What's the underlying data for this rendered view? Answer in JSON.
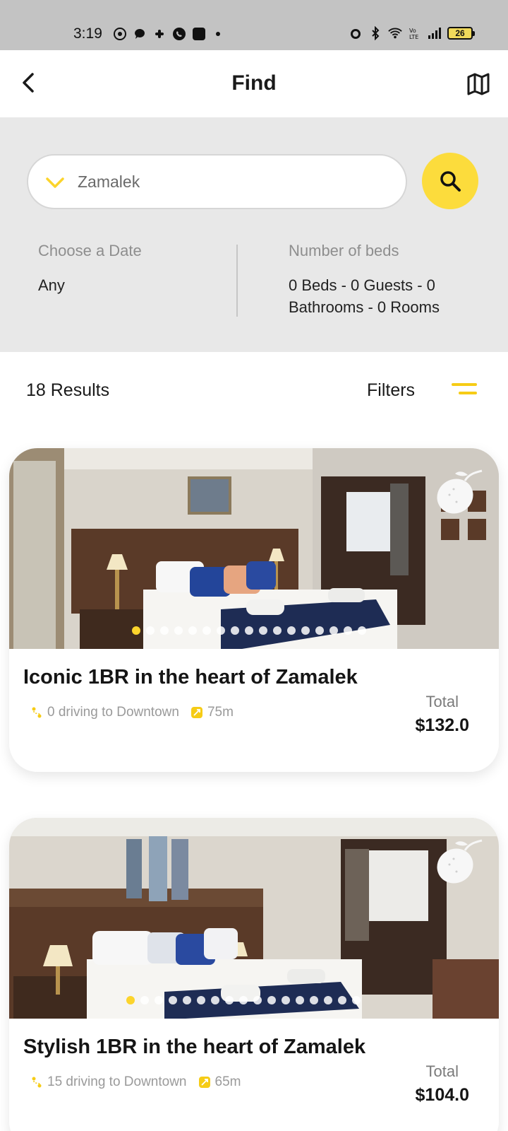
{
  "status_bar": {
    "time": "3:19",
    "battery": "26"
  },
  "header": {
    "title": "Find"
  },
  "search": {
    "location": "Zamalek",
    "date_label": "Choose a Date",
    "date_value": "Any",
    "beds_label": "Number of beds",
    "beds_value": "0 Beds - 0 Guests - 0 Bathrooms - 0 Rooms"
  },
  "results": {
    "count": "18 Results",
    "filters_label": "Filters"
  },
  "listings": [
    {
      "title": "Iconic 1BR in the heart of Zamalek",
      "drive": "0 driving to Downtown",
      "size": "75m",
      "price_label": "Total",
      "price": "$132.0",
      "photo_count": 17,
      "active_photo": 0
    },
    {
      "title": "Stylish 1BR in the heart of Zamalek",
      "drive": "15 driving to Downtown",
      "size": "65m",
      "price_label": "Total",
      "price": "$104.0",
      "photo_count": 17,
      "active_photo": 0
    }
  ],
  "colors": {
    "accent": "#fcdc3c",
    "panel_bg": "#e8e8e8",
    "status_bar_bg": "#c3c3c3"
  },
  "icons": {
    "back": "chevron-left-icon",
    "map": "map-icon",
    "dropdown": "chevron-down-icon",
    "search": "search-icon",
    "filters": "filter-lines-icon",
    "favorite": "lemon-icon",
    "drive": "drive-icon",
    "size": "area-icon"
  }
}
